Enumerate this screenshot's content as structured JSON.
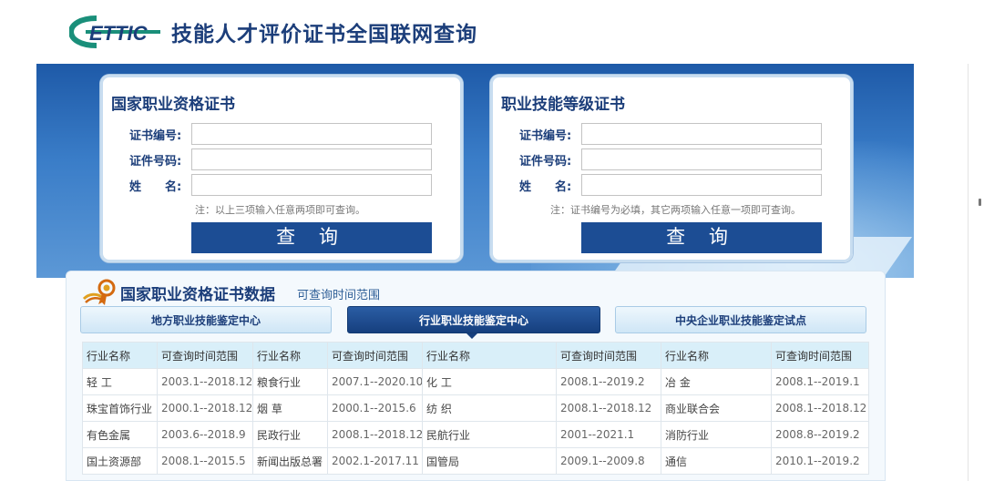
{
  "header": {
    "logo_text": "ETTIC",
    "site_title": "技能人才评价证书全国联网查询"
  },
  "cards": [
    {
      "title": "国家职业资格证书",
      "fields": [
        {
          "label": "证书编号:",
          "value": ""
        },
        {
          "label": "证件号码:",
          "value": ""
        },
        {
          "label": "姓　　名:",
          "value": ""
        }
      ],
      "note": "注：以上三项输入任意两项即可查询。",
      "button": "查 询"
    },
    {
      "title": "职业技能等级证书",
      "fields": [
        {
          "label": "证书编号:",
          "value": ""
        },
        {
          "label": "证件号码:",
          "value": ""
        },
        {
          "label": "姓　　名:",
          "value": ""
        }
      ],
      "note": "注：证书编号为必填，其它两项输入任意一项即可查询。",
      "button": "查 询"
    }
  ],
  "panel": {
    "title": "国家职业资格证书数据",
    "subtitle": "可查询时间范围",
    "tabs": [
      {
        "label": "地方职业技能鉴定中心",
        "active": false
      },
      {
        "label": "行业职业技能鉴定中心",
        "active": true
      },
      {
        "label": "中央企业职业技能鉴定试点",
        "active": false
      }
    ]
  },
  "table": {
    "headers": [
      "行业名称",
      "可查询时间范围",
      "行业名称",
      "可查询时间范围",
      "行业名称",
      "可查询时间范围",
      "行业名称",
      "可查询时间范围"
    ],
    "rows": [
      [
        "轻 工",
        "2003.1--2018.12",
        "粮食行业",
        "2007.1--2020.10",
        "化 工",
        "2008.1--2019.2",
        "冶 金",
        "2008.1--2019.1"
      ],
      [
        "珠宝首饰行业",
        "2000.1--2018.12",
        "烟 草",
        "2000.1--2015.6",
        "纺 织",
        "2008.1--2018.12",
        "商业联合会",
        "2008.1--2018.12"
      ],
      [
        "有色金属",
        "2003.6--2018.9",
        "民政行业",
        "2008.1--2018.12",
        "民航行业",
        "2001--2021.1",
        "消防行业",
        "2008.8--2019.2"
      ],
      [
        "国土资源部",
        "2008.1--2015.5",
        "新闻出版总署",
        "2002.1-2017.11",
        "国管局",
        "2009.1--2009.8",
        "通信",
        "2010.1--2019.2"
      ]
    ]
  },
  "colors": {
    "brand_navy": "#1c3e7a",
    "button_blue": "#1c4d94",
    "logo_teal": "#1a8f7a",
    "banner_blue": "#1e5aa8",
    "table_header_bg": "#d9eff9"
  },
  "icons": {
    "panel_icon": "ribbon-medal-icon"
  }
}
